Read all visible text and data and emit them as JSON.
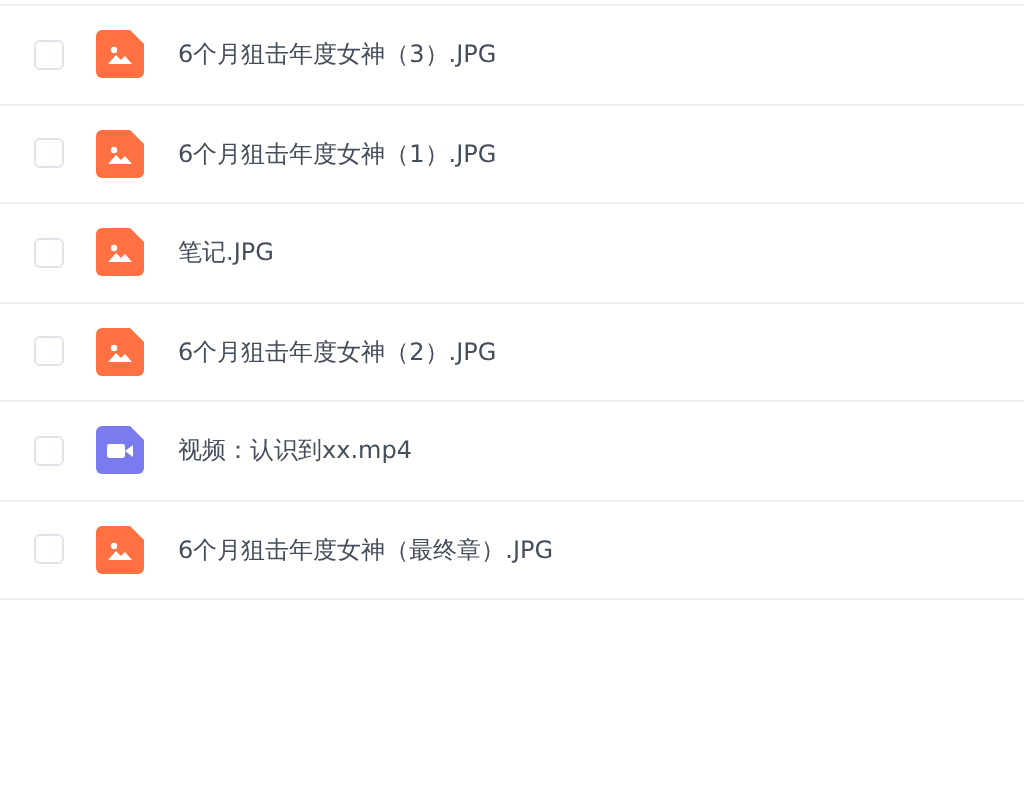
{
  "files": [
    {
      "name": "6个月狙击年度女神（3）.JPG",
      "kind": "image",
      "checked": false
    },
    {
      "name": "6个月狙击年度女神（1）.JPG",
      "kind": "image",
      "checked": false
    },
    {
      "name": "笔记.JPG",
      "kind": "image",
      "checked": false
    },
    {
      "name": "6个月狙击年度女神（2）.JPG",
      "kind": "image",
      "checked": false
    },
    {
      "name": "视频：认识到xx.mp4",
      "kind": "video",
      "checked": false
    },
    {
      "name": "6个月狙击年度女神（最终章）.JPG",
      "kind": "image",
      "checked": false
    }
  ]
}
